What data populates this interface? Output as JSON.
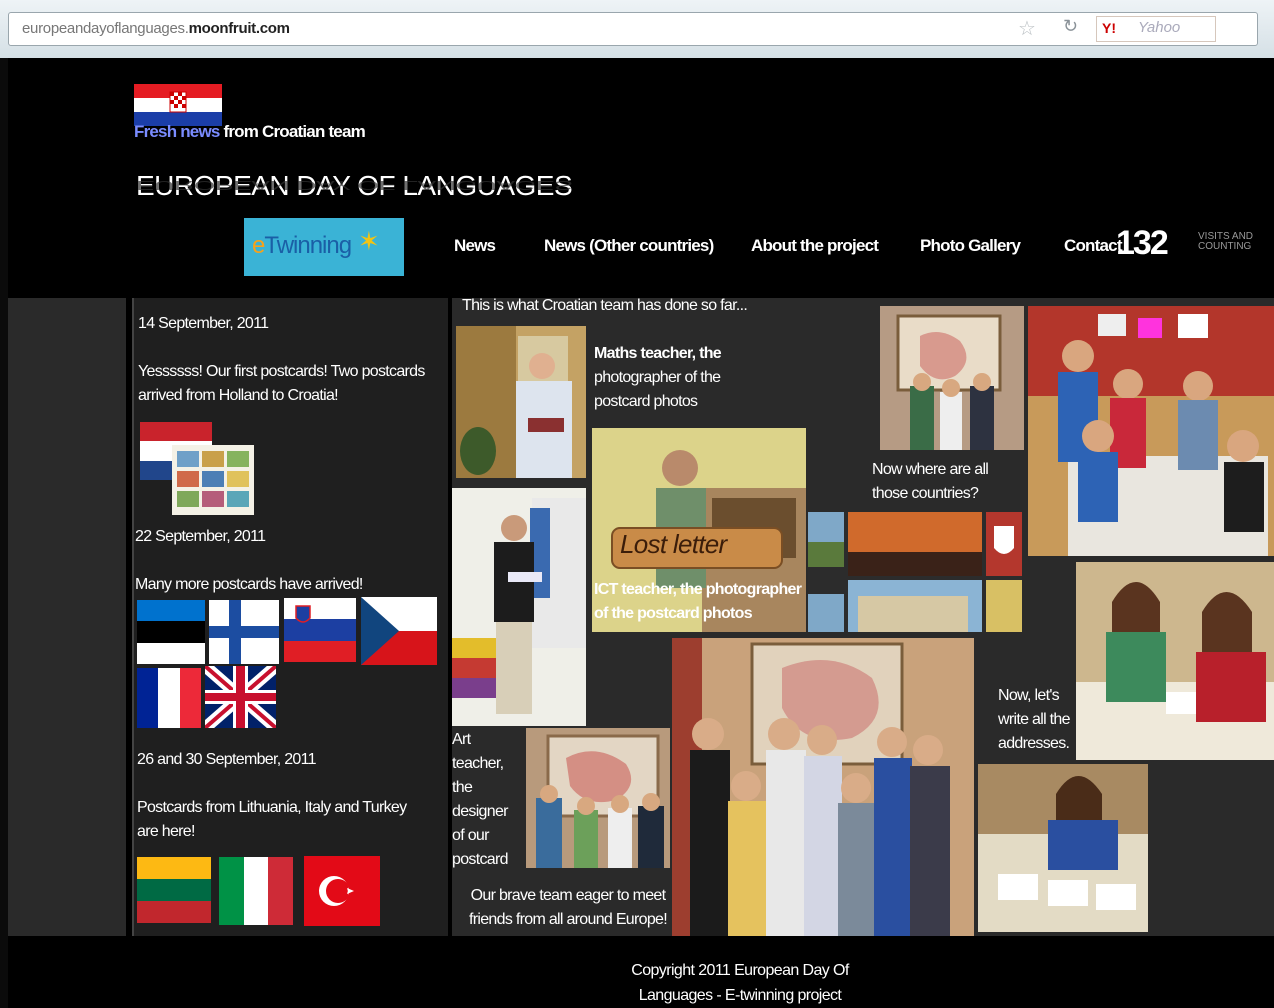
{
  "browser": {
    "url_prefix": "europeandayoflanguages.",
    "url_domain": "moonfruit.com",
    "search_engine": "Yahoo",
    "search_logo": "Y!",
    "icons": [
      "star-icon",
      "reload-icon",
      "yahoo-logo-icon"
    ]
  },
  "header": {
    "fresh_highlight": "Fresh news",
    "fresh_rest": " from Croatian team",
    "title": "EUROPEAN DAY OF LANGUAGES",
    "etwinning": {
      "e": "e",
      "rest": "Twinning"
    }
  },
  "nav": {
    "items": [
      "News",
      "News (Other countries)",
      "About the project",
      "Photo Gallery",
      "Contact"
    ]
  },
  "counter": {
    "value": "132",
    "caption": "VISITS AND COUNTING"
  },
  "news": {
    "entry1": {
      "date": "14 September, 2011",
      "text": "Yessssss! Our first postcards! Two postcards arrived from Holland to Croatia!"
    },
    "entry2": {
      "date": "22 September, 2011",
      "text": "Many more postcards have arrived!"
    },
    "entry3": {
      "date": "26 and 30 September, 2011",
      "text": "Postcards from Lithuania, Italy and Turkey are here!"
    }
  },
  "gallery": {
    "heading": "This is what Croatian team has done so far...",
    "caption_maths_bold": "Maths teacher, the",
    "caption_maths_rest": "photographer of the postcard photos",
    "caption_where": "Now where are all those countries?",
    "caption_ict": "ICT teacher, the photographer of the postcard photos",
    "caption_art": "Art teacher, the designer of our postcard",
    "caption_team": "Our brave team eager to meet friends from all around Europe!",
    "caption_write": "Now, let's write all the addresses.",
    "sign_text": "Lost letter"
  },
  "colors": {
    "page_bg": "#000000",
    "panel_bg": "#2a2a2a",
    "fresh_highlight": "#7a8cff",
    "etwinning_bg": "#3ab3d6"
  },
  "footer": {
    "text": "Copyright 2011 European Day Of Languages - E-twinning project"
  }
}
